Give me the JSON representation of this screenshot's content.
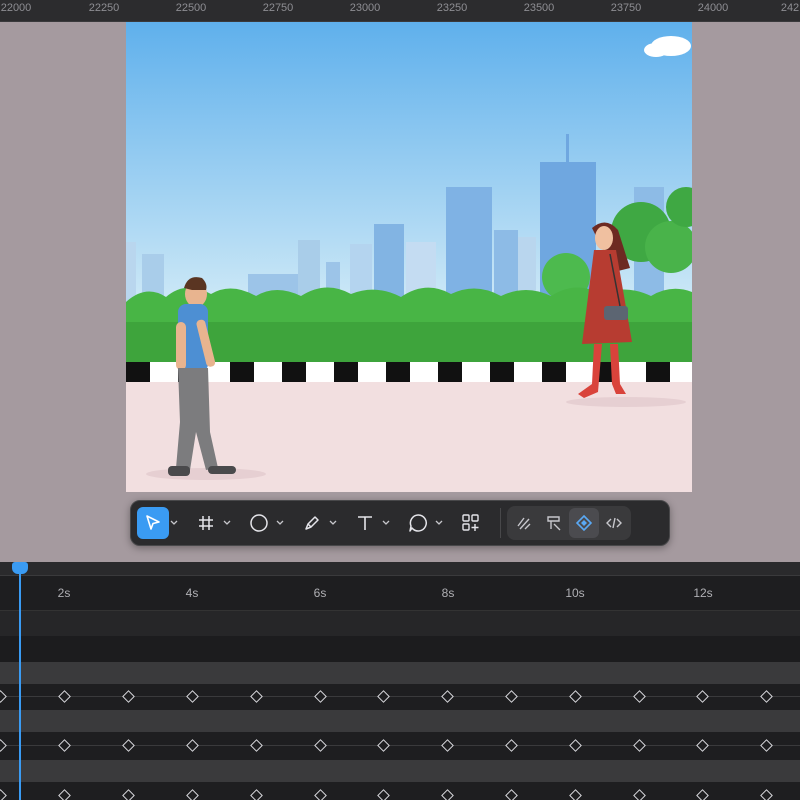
{
  "ruler": {
    "labels": [
      "22000",
      "22250",
      "22500",
      "22750",
      "23000",
      "23250",
      "23500",
      "23750",
      "24000",
      "242"
    ]
  },
  "toolbar": {
    "tools": [
      {
        "name": "select-tool",
        "icon": "pointer-arrow-icon",
        "active": true,
        "has_caret": true
      },
      {
        "name": "frame-tool",
        "icon": "frame-hash-icon",
        "active": false,
        "has_caret": true
      },
      {
        "name": "ellipse-tool",
        "icon": "circle-icon",
        "active": false,
        "has_caret": true
      },
      {
        "name": "pen-tool",
        "icon": "pen-icon",
        "active": false,
        "has_caret": true
      },
      {
        "name": "text-tool",
        "icon": "text-t-icon",
        "active": false,
        "has_caret": true
      },
      {
        "name": "comment-tool",
        "icon": "speech-bubble-icon",
        "active": false,
        "has_caret": true
      },
      {
        "name": "assets-tool",
        "icon": "components-grid-plus-icon",
        "active": false,
        "has_caret": false
      }
    ],
    "modes": [
      {
        "name": "draw-mode",
        "icon": "scribble-icon",
        "active": false
      },
      {
        "name": "design-mode",
        "icon": "brush-icon",
        "active": false
      },
      {
        "name": "animate-mode",
        "icon": "diamond-icon",
        "active": true
      },
      {
        "name": "dev-mode",
        "icon": "code-brackets-icon",
        "active": false
      }
    ]
  },
  "timeline": {
    "time_labels": [
      "2s",
      "4s",
      "6s",
      "8s",
      "10s",
      "12s"
    ],
    "accent_color": "#3a9bf3"
  },
  "colors": {
    "stage_bg": "#a59a9f",
    "toolbar_bg": "#2b2b2d",
    "active_tool": "#3a9bf3"
  }
}
